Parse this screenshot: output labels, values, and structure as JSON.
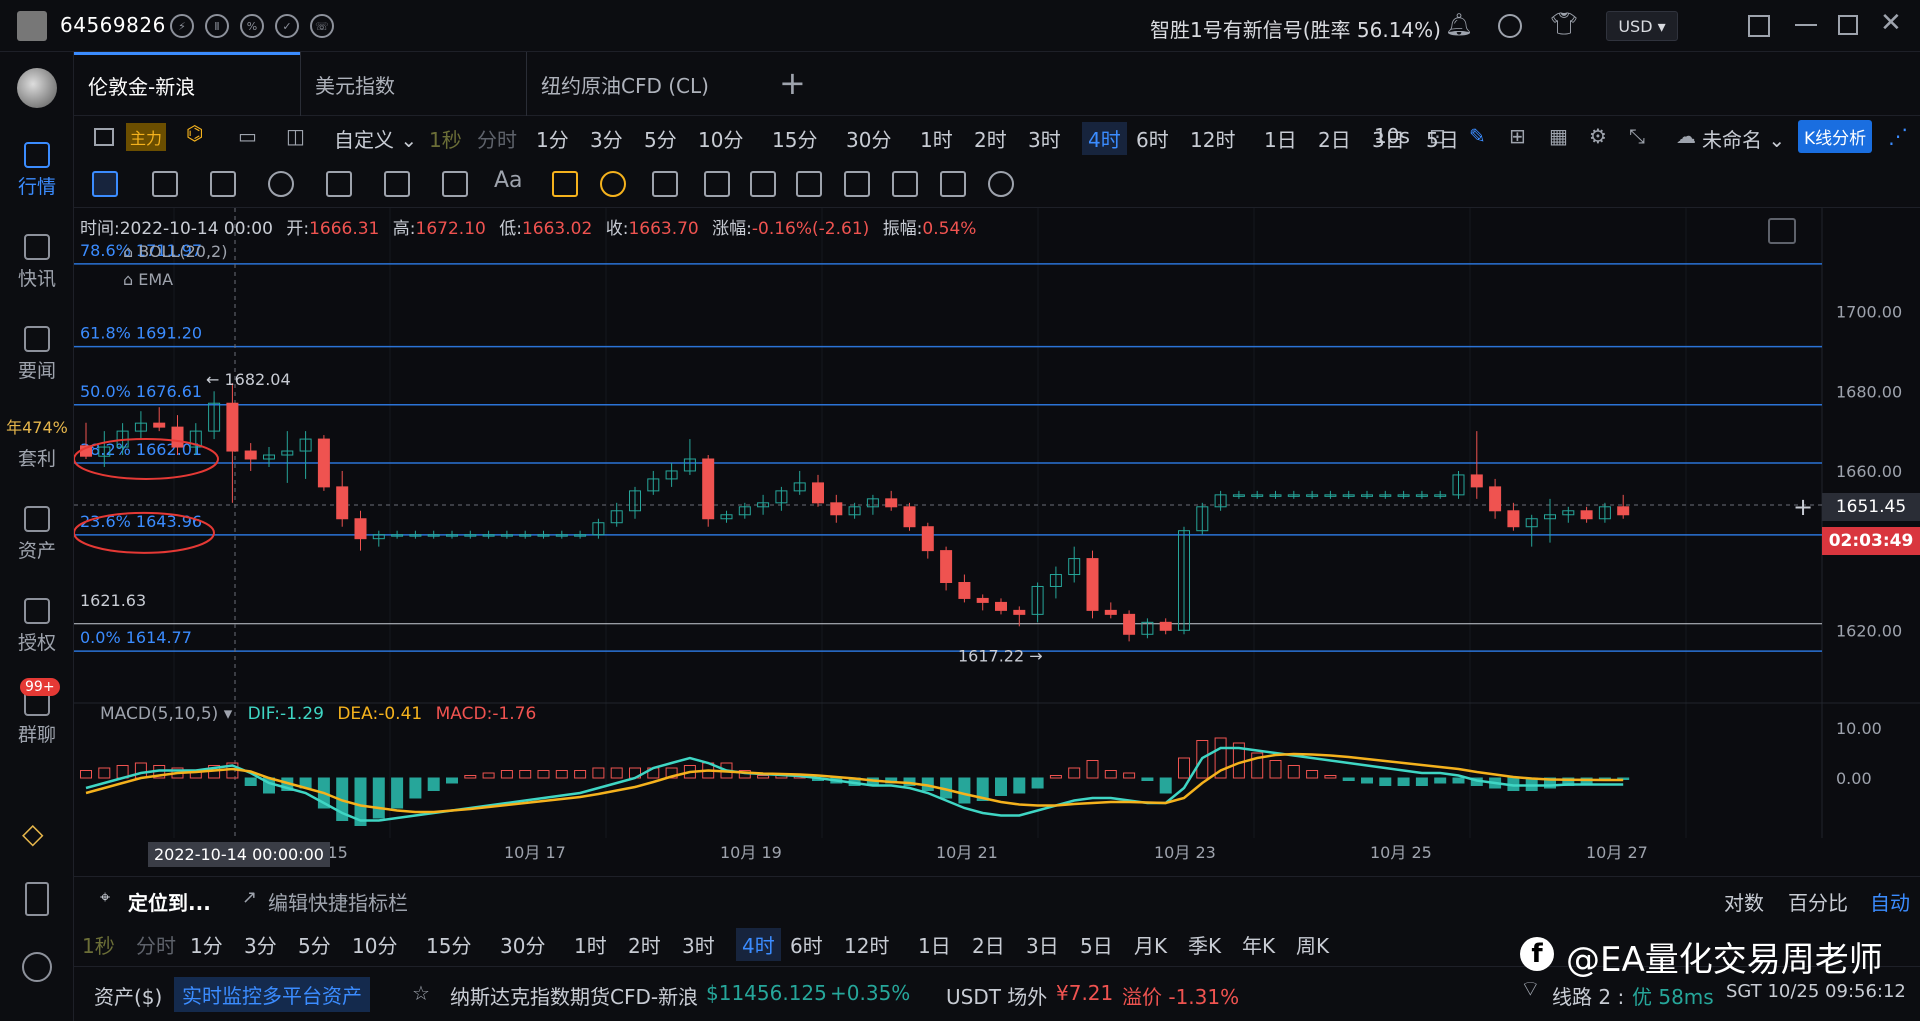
{
  "header": {
    "account": "64569826",
    "signal_text": "智胜1号有新信号(胜率 56.14%)",
    "currency": "USD ▾"
  },
  "sidebar": {
    "items": [
      {
        "label": "行情",
        "badge": "",
        "icon": "b-icon",
        "active": true
      },
      {
        "label": "快讯",
        "badge": "",
        "icon": "news-flash-icon",
        "active": false
      },
      {
        "label": "要闻",
        "badge": "",
        "icon": "document-icon",
        "active": false
      },
      {
        "label": "套利",
        "badge": "年474%",
        "icon": "arbitrage-icon",
        "active": false
      },
      {
        "label": "资产",
        "badge": "",
        "icon": "wallet-icon",
        "active": false
      },
      {
        "label": "授权",
        "badge": "",
        "icon": "key-icon",
        "active": false
      },
      {
        "label": "群聊",
        "badge": "99+",
        "icon": "chat-icon",
        "active": false
      }
    ]
  },
  "tabs": [
    "伦敦金-新浪",
    "美元指数",
    "纽约原油CFD (CL)"
  ],
  "timeframes": {
    "prefix": [
      "主力",
      "自定义 ⌄",
      "1秒",
      "分时"
    ],
    "items": [
      "1分",
      "3分",
      "5分",
      "10分",
      "15分",
      "30分",
      "1时",
      "2时",
      "3时",
      "4时",
      "6时",
      "12时",
      "1日",
      "2日",
      "3日",
      "5日"
    ],
    "selected": "4时",
    "extra": "10s",
    "layout_name": "未命名 ⌄",
    "analysis_button": "K线分析"
  },
  "ohlc": {
    "time_label": "时间:",
    "time": "2022-10-14 00:00",
    "open_label": "开:",
    "open": "1666.31",
    "high_label": "高:",
    "high": "1672.10",
    "low_label": "低:",
    "low": "1663.02",
    "close_label": "收:",
    "close": "1663.70",
    "change_label": "涨幅:",
    "change": "-0.16%(-2.61)",
    "amp_label": "振幅:",
    "amp": "0.54%"
  },
  "indicators": {
    "boll": "BOLL(20,2)",
    "ema": "EMA",
    "macd": "MACD(5,10,5)",
    "dif": "DIF:-1.29",
    "dea": "DEA:-0.41",
    "macd_val": "MACD:-1.76"
  },
  "fib_labels": [
    {
      "text": "78.6% 1711.97",
      "price": 1711.97
    },
    {
      "text": "61.8% 1691.20",
      "price": 1691.2
    },
    {
      "text": "50.0% 1676.61",
      "price": 1676.61
    },
    {
      "text": "38.2% 1662.01",
      "price": 1662.01
    },
    {
      "text": "23.6% 1643.96",
      "price": 1643.96
    },
    {
      "text": "0.0% 1614.77",
      "price": 1614.77
    }
  ],
  "annotations": {
    "high_marker": "← 1682.04",
    "low_marker": "1617.22 →",
    "level_text": "1621.63",
    "current_price": "1651.45",
    "countdown": "02:03:49",
    "crosshair_date": "2022-10-14 00:00:00"
  },
  "price_axis": [
    "1700.00",
    "1680.00",
    "1660.00",
    "1620.00"
  ],
  "macd_axis": [
    "10.00",
    "0.00"
  ],
  "date_axis": [
    "10月 15",
    "10月 17",
    "10月 19",
    "10月 21",
    "10月 23",
    "10月 25",
    "10月 27"
  ],
  "chart_data": {
    "type": "candlestick",
    "title": "",
    "x_labels": [
      "10月 15",
      "10月 17",
      "10月 19",
      "10月 21",
      "10月 23",
      "10月 25",
      "10月 27"
    ],
    "y_ticks": [
      1700,
      1680,
      1660,
      1620
    ],
    "ylim": [
      1602,
      1724
    ],
    "candles": [
      [
        1666.3,
        1672.1,
        1663.0,
        1663.7
      ],
      [
        1663.7,
        1670,
        1661,
        1666
      ],
      [
        1666,
        1672,
        1664,
        1670
      ],
      [
        1670,
        1675,
        1668,
        1672
      ],
      [
        1672,
        1676,
        1670,
        1671
      ],
      [
        1671,
        1674,
        1664,
        1666
      ],
      [
        1666,
        1672,
        1664,
        1670
      ],
      [
        1670,
        1680,
        1668,
        1677
      ],
      [
        1677,
        1682.04,
        1652,
        1665
      ],
      [
        1665,
        1667,
        1660,
        1663
      ],
      [
        1663,
        1666,
        1661,
        1664
      ],
      [
        1664,
        1670,
        1657,
        1665
      ],
      [
        1665,
        1670,
        1658,
        1668
      ],
      [
        1668,
        1669,
        1655,
        1656
      ],
      [
        1656,
        1660,
        1646,
        1648
      ],
      [
        1648,
        1650,
        1640,
        1643
      ],
      [
        1643,
        1645,
        1641,
        1644
      ],
      [
        1644,
        1645,
        1643,
        1644
      ],
      [
        1644,
        1645,
        1643,
        1644
      ],
      [
        1644,
        1645,
        1643,
        1644
      ],
      [
        1644,
        1645,
        1643,
        1644
      ],
      [
        1644,
        1645,
        1643,
        1644
      ],
      [
        1644,
        1645,
        1643,
        1644
      ],
      [
        1644,
        1645,
        1643,
        1644
      ],
      [
        1644,
        1645,
        1643,
        1644
      ],
      [
        1644,
        1645,
        1643,
        1644
      ],
      [
        1644,
        1645,
        1643,
        1644
      ],
      [
        1644,
        1645,
        1643,
        1644
      ],
      [
        1644,
        1648,
        1643,
        1647
      ],
      [
        1647,
        1652,
        1646,
        1650
      ],
      [
        1650,
        1656,
        1648,
        1655
      ],
      [
        1655,
        1660,
        1654,
        1658
      ],
      [
        1658,
        1662,
        1656,
        1660
      ],
      [
        1660,
        1668,
        1659,
        1663
      ],
      [
        1663,
        1664,
        1646,
        1648
      ],
      [
        1648,
        1650,
        1647,
        1649
      ],
      [
        1649,
        1652,
        1648,
        1651
      ],
      [
        1651,
        1654,
        1649,
        1652
      ],
      [
        1652,
        1656,
        1650,
        1655
      ],
      [
        1655,
        1660,
        1654,
        1657
      ],
      [
        1657,
        1659,
        1651,
        1652
      ],
      [
        1652,
        1654,
        1647,
        1649
      ],
      [
        1649,
        1652,
        1648,
        1651
      ],
      [
        1651,
        1654,
        1649,
        1653
      ],
      [
        1653,
        1655,
        1650,
        1651
      ],
      [
        1651,
        1652,
        1645,
        1646
      ],
      [
        1646,
        1647,
        1638,
        1640
      ],
      [
        1640,
        1641,
        1630,
        1632
      ],
      [
        1632,
        1634,
        1627,
        1628
      ],
      [
        1628,
        1629,
        1625,
        1627
      ],
      [
        1627,
        1628,
        1624,
        1625
      ],
      [
        1625,
        1626,
        1621,
        1624
      ],
      [
        1624,
        1632,
        1622,
        1631
      ],
      [
        1631,
        1636,
        1628,
        1634
      ],
      [
        1634,
        1641,
        1632,
        1638
      ],
      [
        1638,
        1640,
        1623,
        1625
      ],
      [
        1625,
        1627,
        1623,
        1624
      ],
      [
        1624,
        1625,
        1617.22,
        1619
      ],
      [
        1619,
        1623,
        1618,
        1622
      ],
      [
        1622,
        1623,
        1619,
        1620
      ],
      [
        1620,
        1646,
        1619,
        1645
      ],
      [
        1645,
        1652,
        1644,
        1651
      ],
      [
        1651,
        1655,
        1650,
        1654
      ],
      [
        1654,
        1655,
        1653,
        1654
      ],
      [
        1654,
        1655,
        1653,
        1654
      ],
      [
        1654,
        1655,
        1653,
        1654
      ],
      [
        1654,
        1655,
        1653,
        1654
      ],
      [
        1654,
        1655,
        1653,
        1654
      ],
      [
        1654,
        1655,
        1653,
        1654
      ],
      [
        1654,
        1655,
        1653,
        1654
      ],
      [
        1654,
        1655,
        1653,
        1654
      ],
      [
        1654,
        1655,
        1653,
        1654
      ],
      [
        1654,
        1655,
        1653,
        1654
      ],
      [
        1654,
        1655,
        1653,
        1654
      ],
      [
        1654,
        1655,
        1653,
        1654
      ],
      [
        1654,
        1660,
        1653,
        1659
      ],
      [
        1659,
        1670,
        1653,
        1656
      ],
      [
        1656,
        1658,
        1648,
        1650
      ],
      [
        1650,
        1652,
        1645,
        1646
      ],
      [
        1646,
        1649,
        1641,
        1648
      ],
      [
        1648,
        1653,
        1642,
        1649
      ],
      [
        1649,
        1651,
        1647,
        1650
      ],
      [
        1650,
        1651,
        1647,
        1648
      ],
      [
        1648,
        1652,
        1647,
        1651
      ],
      [
        1651,
        1654,
        1648,
        1649
      ]
    ],
    "macd_hist": [
      1.5,
      2.0,
      2.5,
      3.0,
      2.5,
      2.0,
      1.5,
      2.5,
      3.0,
      -1.5,
      -3.0,
      -2.5,
      -2.0,
      -6.0,
      -8.5,
      -9.5,
      -8.0,
      -6.0,
      -4.0,
      -2.5,
      -1.0,
      0.5,
      1.0,
      1.5,
      1.5,
      1.5,
      1.5,
      1.5,
      2.0,
      2.0,
      2.0,
      2.0,
      2.0,
      2.5,
      3.0,
      3.0,
      1.5,
      0.5,
      0.5,
      0.5,
      -0.5,
      -1.0,
      -1.5,
      -1.5,
      -1.0,
      -1.5,
      -2.5,
      -4.0,
      -5.0,
      -4.5,
      -3.5,
      -3.0,
      -2.0,
      0.5,
      2.0,
      3.5,
      1.5,
      1.0,
      -0.5,
      -3.0,
      4.0,
      7.5,
      8.0,
      7.0,
      5.0,
      3.5,
      2.5,
      1.5,
      0.5,
      -0.5,
      -1.0,
      -1.5,
      -1.5,
      -1.5,
      -1.0,
      -1.0,
      -1.5,
      -2.0,
      -2.5,
      -2.5,
      -2.0,
      -1.5,
      -1.0,
      -0.5,
      -0.3
    ],
    "macd_dif": [
      -2,
      -1,
      0,
      1,
      1.5,
      1.5,
      1.5,
      2,
      2.5,
      1,
      -1,
      -2,
      -3,
      -5,
      -7,
      -8.5,
      -8.5,
      -8,
      -7.5,
      -7,
      -6.5,
      -6,
      -5.5,
      -5,
      -4.5,
      -4,
      -3.5,
      -3,
      -2,
      -1,
      0,
      2,
      3,
      4,
      3,
      1.5,
      1,
      0.8,
      0.6,
      0.4,
      0,
      -0.5,
      -1,
      -1.5,
      -1.5,
      -2,
      -3,
      -4.5,
      -6,
      -7,
      -7.5,
      -7.5,
      -6.5,
      -5.5,
      -4.5,
      -4,
      -4,
      -4.5,
      -5,
      -5,
      -2,
      4,
      6,
      6,
      5.5,
      5,
      4.5,
      4,
      3.5,
      3,
      2.5,
      2,
      1.5,
      1,
      1,
      0.5,
      -0.5,
      -1,
      -1.5,
      -1.5,
      -1.5,
      -1.3,
      -1.3,
      -1.3,
      -1.29
    ],
    "macd_dea": [
      -3,
      -2,
      -1,
      0,
      0.5,
      1,
      1.2,
      1.5,
      1.8,
      1.3,
      0,
      -1,
      -2,
      -3,
      -4.5,
      -5.5,
      -6,
      -6.5,
      -6.8,
      -6.8,
      -6.5,
      -6.2,
      -5.8,
      -5.4,
      -5,
      -4.6,
      -4.2,
      -3.8,
      -3.2,
      -2.5,
      -1.8,
      -0.8,
      0.3,
      1.2,
      1.5,
      1.3,
      1.1,
      0.9,
      0.8,
      0.7,
      0.5,
      0.2,
      -0.1,
      -0.5,
      -0.8,
      -1,
      -1.5,
      -2.3,
      -3.2,
      -4,
      -4.8,
      -5.3,
      -5.5,
      -5.5,
      -5.2,
      -5,
      -4.8,
      -4.8,
      -4.9,
      -5,
      -4,
      -1,
      1.5,
      3,
      4,
      4.6,
      4.8,
      4.7,
      4.5,
      4.2,
      3.8,
      3.4,
      3,
      2.6,
      2.2,
      1.8,
      1.2,
      0.7,
      0.2,
      -0.1,
      -0.3,
      -0.35,
      -0.38,
      -0.4,
      -0.41
    ],
    "macd_ylim": [
      -12,
      14
    ]
  },
  "bottom": {
    "locate": "定位到...",
    "edit_bar": "编辑快捷指标栏",
    "scale_opts": [
      "对数",
      "百分比",
      "自动"
    ],
    "timeframes": [
      "1秒",
      "分时",
      "1分",
      "3分",
      "5分",
      "10分",
      "15分",
      "30分",
      "1时",
      "2时",
      "3时",
      "4时",
      "6时",
      "12时",
      "1日",
      "2日",
      "3日",
      "5日",
      "月K",
      "季K",
      "年K",
      "周K"
    ],
    "selected": "4时"
  },
  "status_bar": {
    "assets": "资产($)",
    "monitor": "实时监控多平台资产",
    "instrument": "纳斯达克指数期货CFD-新浪",
    "price": "$11456.125",
    "change": "+0.35%",
    "usdt": "USDT 场外",
    "usdt_price": "¥7.21",
    "premium": "溢价 -1.31%",
    "line": "线路 2 :",
    "latency": "优 58ms",
    "clock": "SGT  10/25 09:56:12",
    "watermark": "@EA量化交易周老师"
  },
  "colors": {
    "up": "#26a69a",
    "down": "#ef5350",
    "accent": "#3b8cff",
    "fib": "#2b73d6",
    "dif": "#3fd6c4",
    "dea": "#f5b21d"
  }
}
